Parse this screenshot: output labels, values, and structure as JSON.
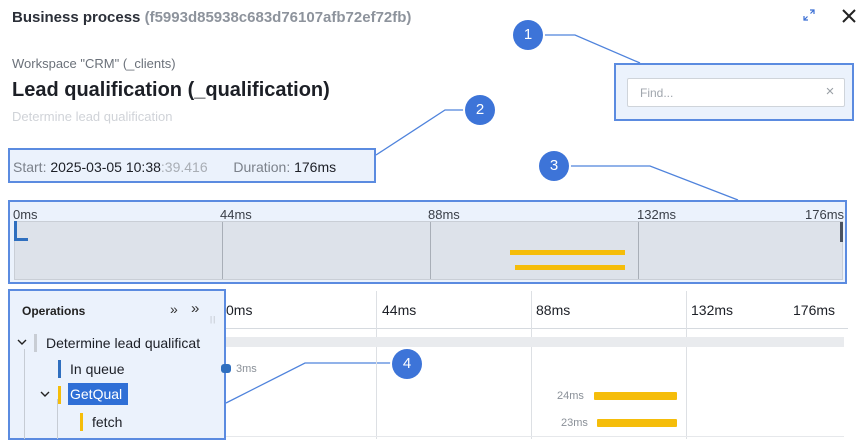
{
  "header": {
    "title": "Business process",
    "process_id": "(f5993d85938c683d76107afb72ef72fb)",
    "expand_icon": "expand-diagonal-icon",
    "close_icon": "close-icon"
  },
  "workspace": "Workspace \"CRM\" (_clients)",
  "process": {
    "title": "Lead qualification (_qualification)",
    "subtitle": "Determine lead qualification"
  },
  "search": {
    "placeholder": "Find...",
    "value": ""
  },
  "stats": {
    "start_label": "Start:",
    "start_value": "2025-03-05 10:38",
    "start_ms": ":39.416",
    "duration_label": "Duration:",
    "duration_value": "176ms"
  },
  "overview": {
    "ticks": [
      "0ms",
      "44ms",
      "88ms",
      "132ms",
      "176ms"
    ]
  },
  "operations": {
    "title": "Operations",
    "items": [
      {
        "label": "Determine lead qualificat",
        "depth": 0,
        "expanded": true,
        "color": "#c8cdd4"
      },
      {
        "label": "In queue",
        "depth": 1,
        "color": "#2f6fbf"
      },
      {
        "label": "GetQual",
        "depth": 1,
        "expanded": true,
        "selected": true,
        "color": "#f5bd0a"
      },
      {
        "label": "fetch",
        "depth": 2,
        "color": "#f5bd0a"
      }
    ]
  },
  "timeline": {
    "ticks": [
      "0ms",
      "44ms",
      "88ms",
      "132ms",
      "176ms"
    ],
    "bars": [
      {
        "name": "In queue",
        "duration": "3ms"
      },
      {
        "name": "GetQual",
        "duration": "24ms"
      },
      {
        "name": "fetch",
        "duration": "23ms"
      }
    ]
  },
  "callouts": [
    "1",
    "2",
    "3",
    "4"
  ],
  "colors": {
    "accent": "#3d74d8",
    "callout_border": "#5b8be0",
    "bar_yellow": "#f5bd0a",
    "queue_blue": "#2f6fbf",
    "selection": "#2f6fd6"
  }
}
